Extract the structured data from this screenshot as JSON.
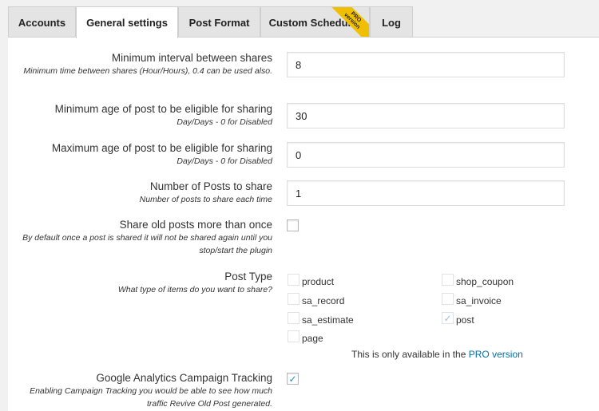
{
  "tabs": [
    {
      "label": "Accounts"
    },
    {
      "label": "General settings"
    },
    {
      "label": "Post Format"
    },
    {
      "label": "Custom Schedule"
    },
    {
      "label": "Log"
    }
  ],
  "pro_ribbon": {
    "line1": "PRO",
    "line2": "version"
  },
  "settings": {
    "min_interval": {
      "label": "Minimum interval between shares",
      "desc": "Minimum time between shares (Hour/Hours), 0.4 can be used also.",
      "value": "8"
    },
    "min_age": {
      "label": "Minimum age of post to be eligible for sharing",
      "desc": "Day/Days - 0 for Disabled",
      "value": "30"
    },
    "max_age": {
      "label": "Maximum age of post to be eligible for sharing",
      "desc": "Day/Days - 0 for Disabled",
      "value": "0"
    },
    "num_posts": {
      "label": "Number of Posts to share",
      "desc": "Number of posts to share each time",
      "value": "1"
    },
    "share_more": {
      "label": "Share old posts more than once",
      "desc": "By default once a post is shared it will not be shared again until you stop/start the plugin",
      "checked": false
    },
    "post_type": {
      "label": "Post Type",
      "desc": "What type of items do you want to share?",
      "options": [
        {
          "label": "product",
          "checked": false
        },
        {
          "label": "shop_coupon",
          "checked": false
        },
        {
          "label": "sa_record",
          "checked": false
        },
        {
          "label": "sa_invoice",
          "checked": false
        },
        {
          "label": "sa_estimate",
          "checked": false
        },
        {
          "label": "post",
          "checked": true
        },
        {
          "label": "page",
          "checked": false
        }
      ],
      "pro_note_prefix": "This is only available in the",
      "pro_note_link": "PRO version"
    },
    "ga_tracking": {
      "label": "Google Analytics Campaign Tracking",
      "desc": "Enabling Campaign Tracking you would be able to see how much traffic Revive Old Post generated.",
      "checked": true
    }
  },
  "check_glyph": "✓"
}
